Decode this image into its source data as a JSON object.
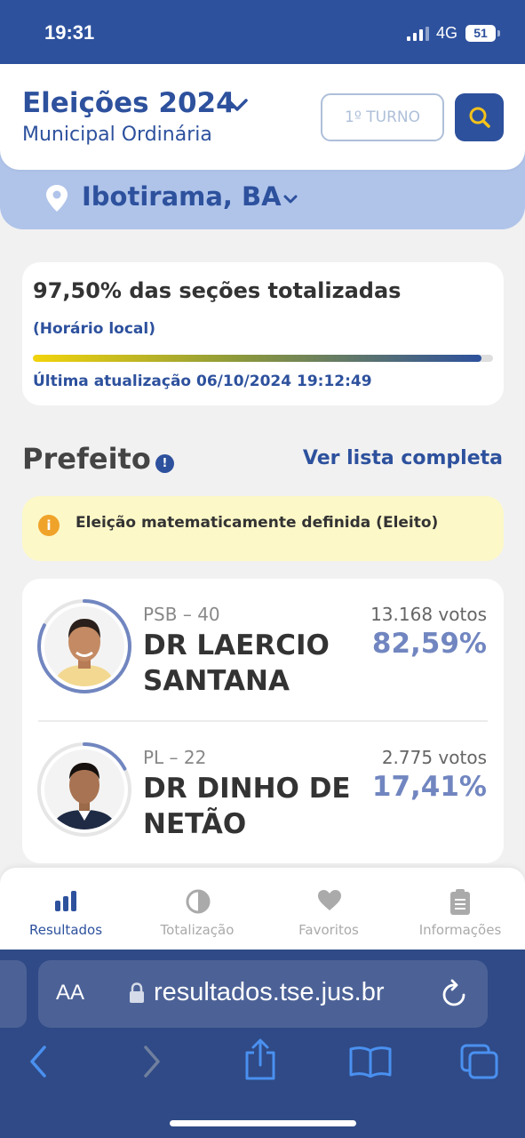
{
  "status_bar": {
    "time": "19:31",
    "network": "4G",
    "battery": "51"
  },
  "header": {
    "title": "Eleições 2024",
    "subtitle": "Municipal Ordinária",
    "turno_button": "1º TURNO",
    "location": "Ibotirama, BA"
  },
  "progress": {
    "sections_label": "97,50% das seções totalizadas",
    "timezone_label": "(Horário local)",
    "percent": 97.5,
    "last_update": "Última atualização 06/10/2024 19:12:49"
  },
  "section": {
    "title": "Prefeito",
    "info_icon": "!",
    "see_all": "Ver lista completa"
  },
  "alert": {
    "icon": "i",
    "text": "Eleição matematicamente definida (Eleito)"
  },
  "candidates": [
    {
      "party": "PSB – 40",
      "name": "DR LAERCIO SANTANA",
      "votes": "13.168 votos",
      "percent_label": "82,59%",
      "percent": 82.59
    },
    {
      "party": "PL – 22",
      "name": "DR DINHO DE NETÃO",
      "votes": "2.775 votos",
      "percent_label": "17,41%",
      "percent": 17.41
    }
  ],
  "tabs": [
    {
      "label": "Resultados",
      "icon": "bar-chart-icon",
      "active": true
    },
    {
      "label": "Totalização",
      "icon": "pie-icon",
      "active": false
    },
    {
      "label": "Favoritos",
      "icon": "heart-icon",
      "active": false
    },
    {
      "label": "Informações",
      "icon": "clipboard-icon",
      "active": false
    }
  ],
  "browser": {
    "text_size": "AA",
    "url": "resultados.tse.jus.br"
  },
  "colors": {
    "primary": "#2d519d",
    "accent_light": "#b0c4ea",
    "percent": "#7186c0",
    "alert_bg": "#fdf8c8",
    "alert_icon": "#f0a32a"
  }
}
